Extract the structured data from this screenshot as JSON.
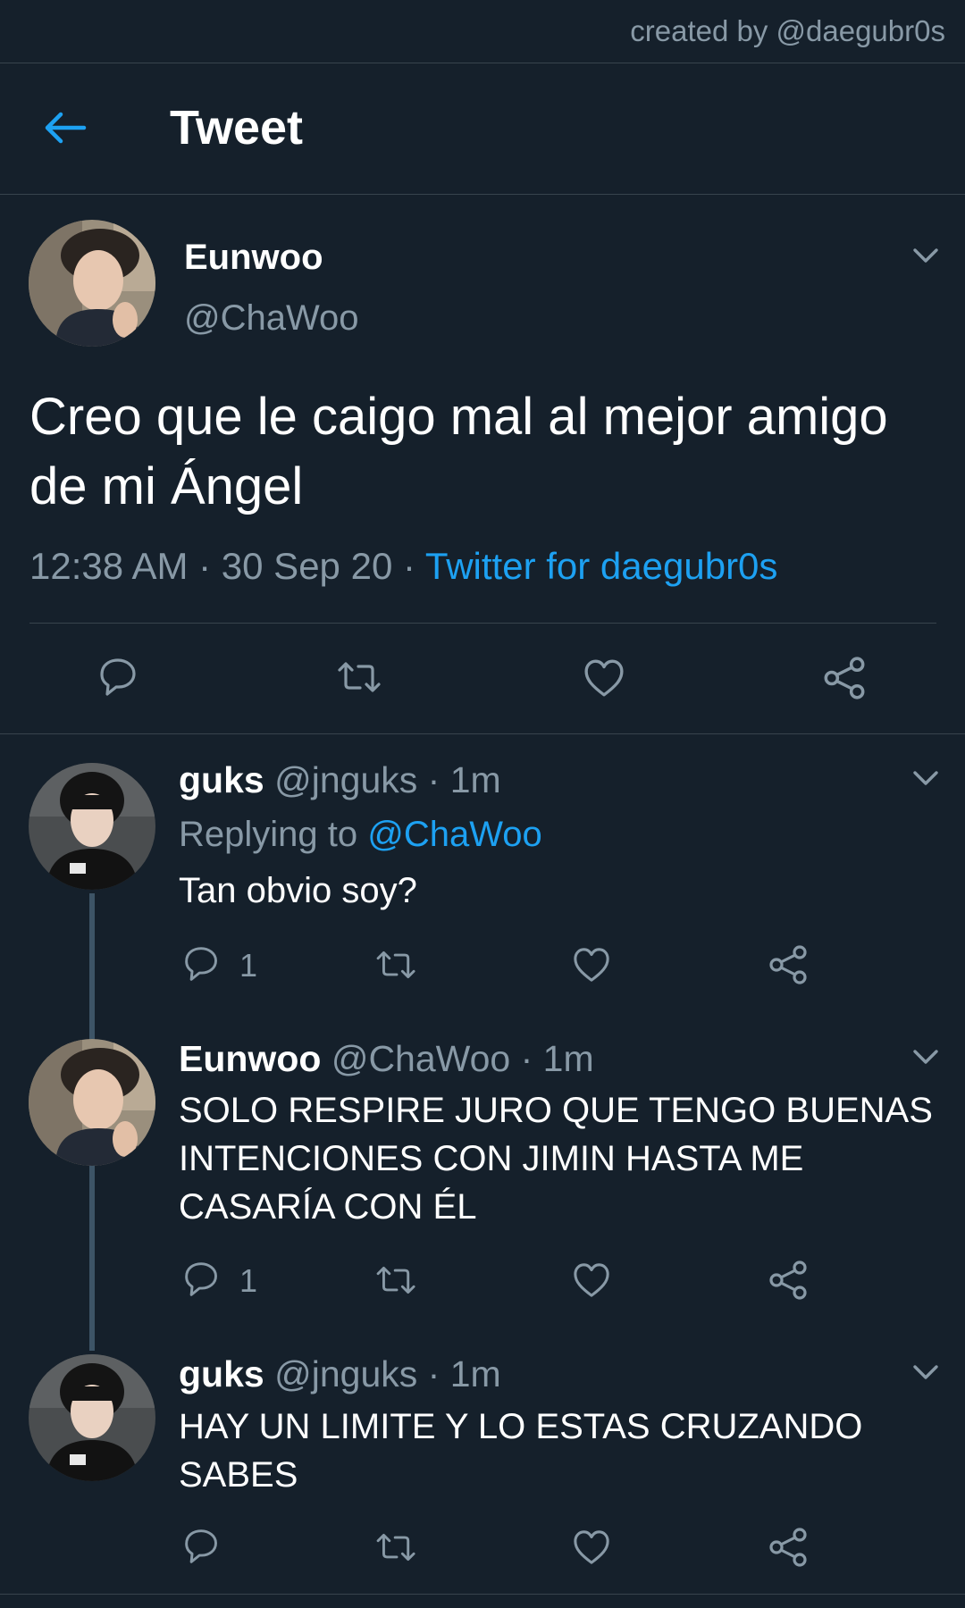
{
  "credit": "created by @daegubr0s",
  "header": {
    "title": "Tweet"
  },
  "main_tweet": {
    "name": "Eunwoo",
    "handle": "@ChaWoo",
    "text": "Creo que le caigo mal al mejor amigo de mi Ángel",
    "time": "12:38 AM",
    "date": "30 Sep 20",
    "separator": " · ",
    "source": "Twitter for daegubr0s"
  },
  "replies": [
    {
      "name": "guks",
      "handle": "@jnguks",
      "time": "1m",
      "replying_label": "Replying to",
      "replying_to": "@ChaWoo",
      "text": "Tan obvio soy?",
      "reply_count": "1"
    },
    {
      "name": "Eunwoo",
      "handle": "@ChaWoo",
      "time": "1m",
      "text": "SOLO RESPIRE JURO QUE TENGO BUENAS INTENCIONES CON JIMIN HASTA ME CASARÍA CON ÉL",
      "reply_count": "1"
    },
    {
      "name": "guks",
      "handle": "@jnguks",
      "time": "1m",
      "text": "HAY UN LIMITE Y LO ESTAS CRUZANDO SABES"
    }
  ],
  "icons": [
    "back-arrow-icon",
    "chevron-down-icon",
    "reply-icon",
    "retweet-icon",
    "like-icon",
    "share-icon"
  ],
  "colors": {
    "background": "#15202b",
    "accent": "#1da1f2",
    "muted": "#8899a6",
    "divider": "#38444d"
  }
}
